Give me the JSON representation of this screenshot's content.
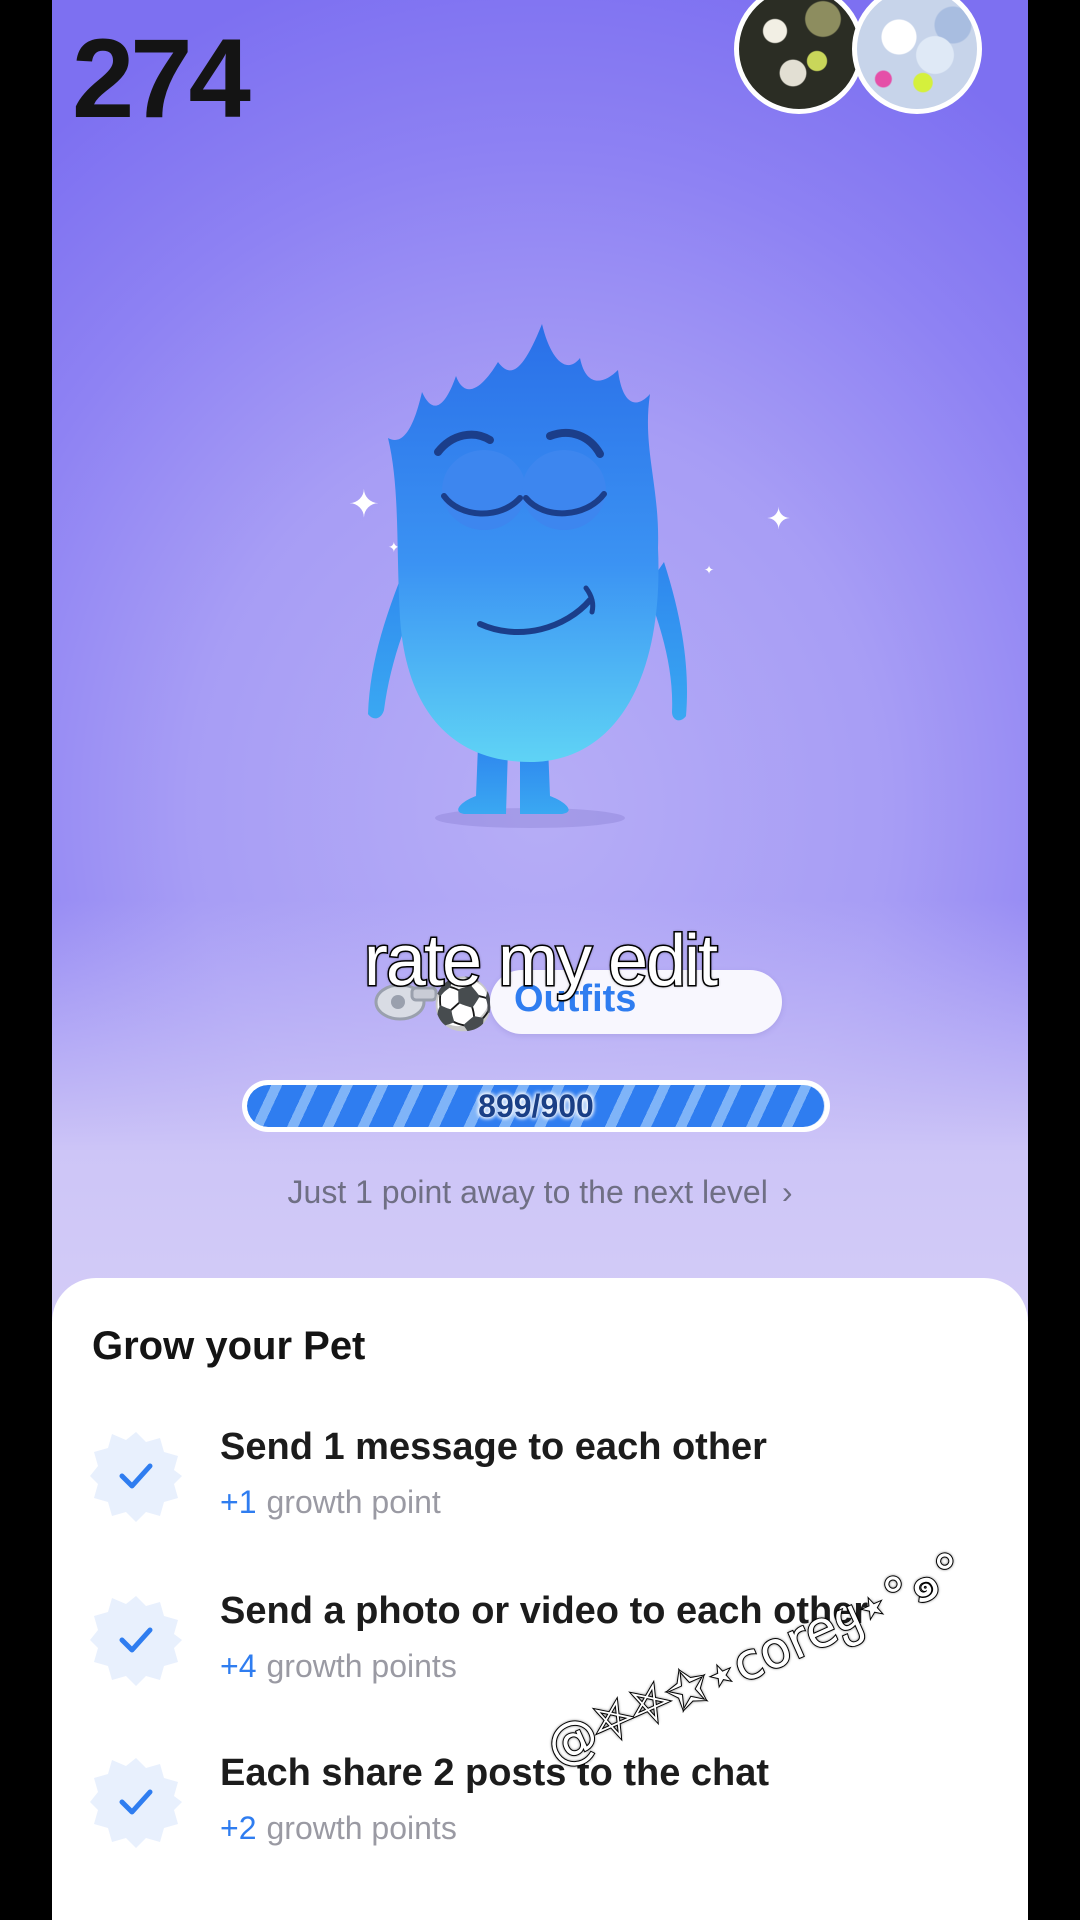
{
  "header": {
    "streak_count": "274"
  },
  "overlay": {
    "caption": "rate my edit",
    "watermark": "@⛧⛧✩⋆coreყ⋆°๑°"
  },
  "pet": {
    "outfits_label": "Outfits",
    "progress": {
      "text": "899/900",
      "current": 899,
      "max": 900
    },
    "next_level_text": "Just 1 point away to the next level"
  },
  "tasks_card": {
    "title": "Grow your Pet",
    "tasks": [
      {
        "title": "Send 1 message to each other",
        "points_plus": "+1",
        "points_label": "growth point",
        "completed": true
      },
      {
        "title": "Send a photo or video to each other",
        "points_plus": "+4",
        "points_label": "growth points",
        "completed": true
      },
      {
        "title": "Each share 2 posts to the chat",
        "points_plus": "+2",
        "points_label": "growth points",
        "completed": true
      }
    ]
  },
  "colors": {
    "accent": "#2f7df0",
    "background_top": "#7d70f1",
    "pet_body": "#3a8cf2"
  },
  "icons": {
    "check": "check-icon",
    "chevron": "chevron-right-icon",
    "sparkle": "sparkle-icon",
    "whistle": "whistle-icon",
    "ball": "soccer-ball-icon"
  }
}
